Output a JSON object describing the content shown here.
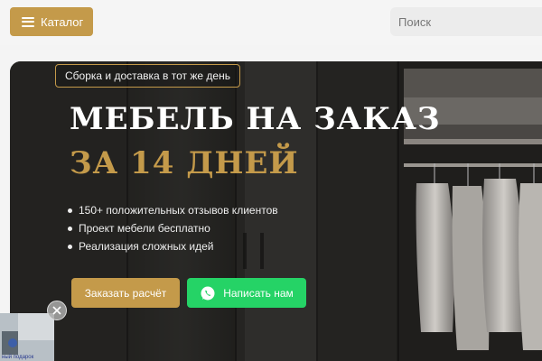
{
  "header": {
    "catalog_label": "Каталог",
    "search_placeholder": "Поиск"
  },
  "hero": {
    "badge": "Сборка и доставка в тот же день",
    "title_line1": "МЕБЕЛЬ НА ЗАКАЗ",
    "title_line2": "ЗА 14 ДНЕЙ",
    "bullets": [
      "150+ положительных отзывов клиентов",
      "Проект мебели бесплатно",
      "Реализация сложных идей"
    ],
    "order_button": "Заказать расчёт",
    "whatsapp_button": "Написать нам"
  },
  "widget": {
    "video_caption": "ный подарок"
  },
  "colors": {
    "accent": "#c49a4a",
    "whatsapp": "#25d366",
    "header_bg": "#f5f5f5"
  },
  "icons": {
    "catalog": "menu-icon",
    "whatsapp": "whatsapp-icon",
    "close": "close-icon"
  }
}
